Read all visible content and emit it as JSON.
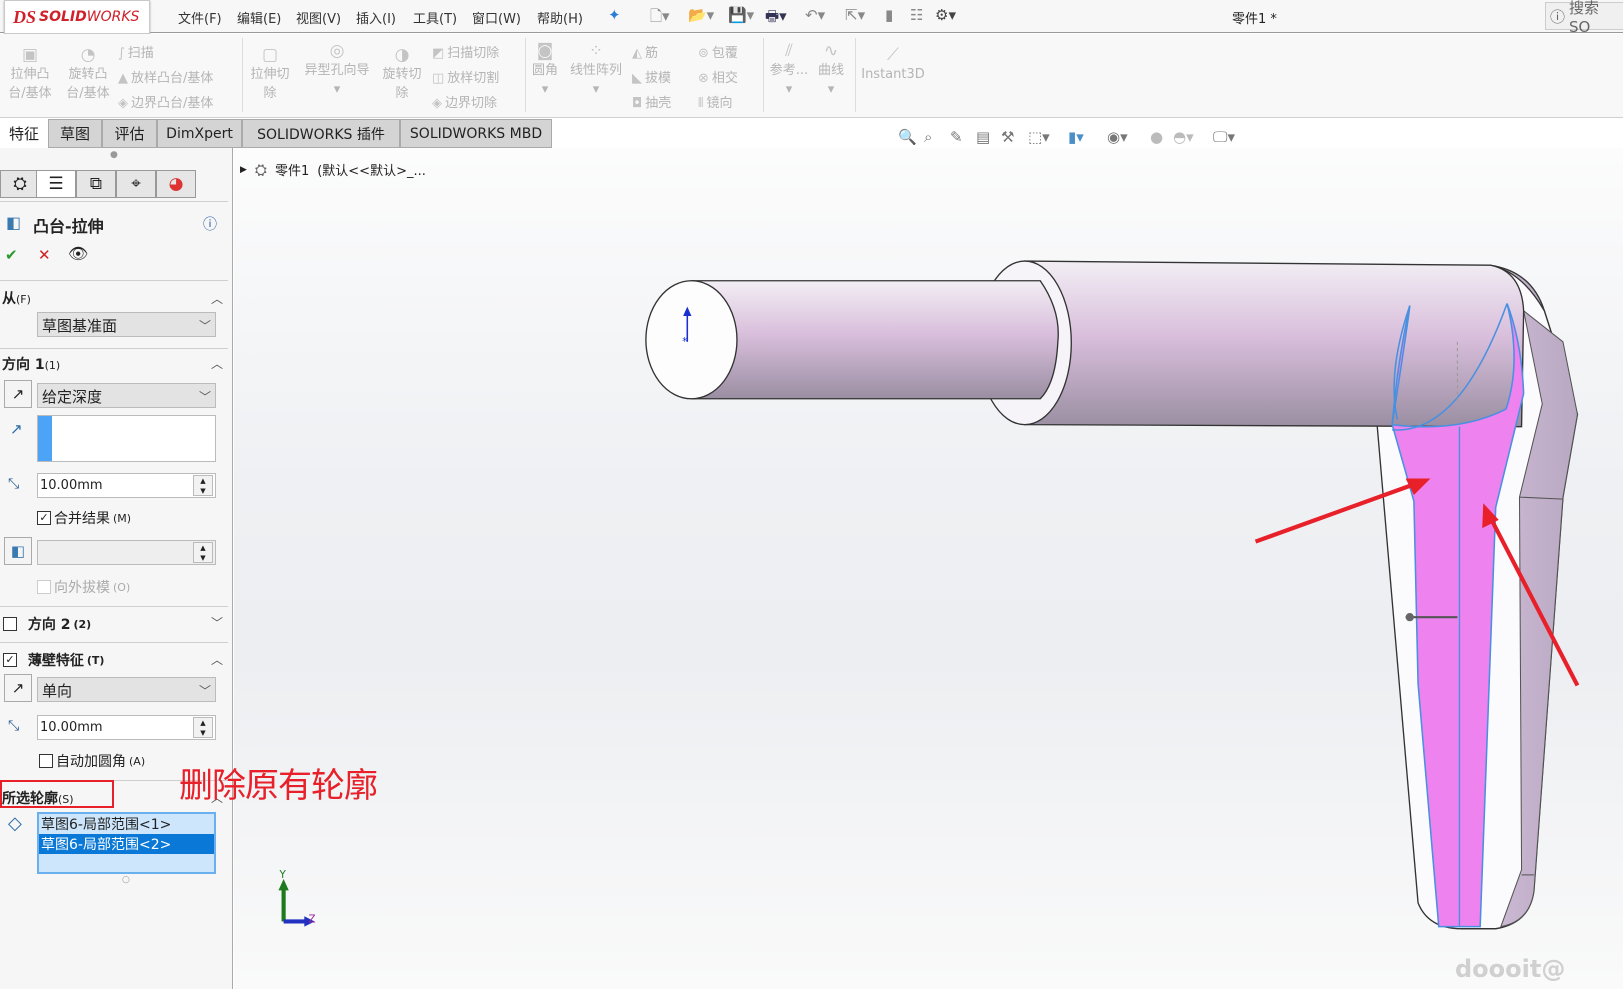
{
  "app": {
    "logo_ds": "DS",
    "logo_text_bold": "SOLID",
    "logo_text_light": "WORKS",
    "document_title": "零件1 *",
    "search_label": "搜索 SO"
  },
  "menu": [
    "文件(F)",
    "编辑(E)",
    "视图(V)",
    "插入(I)",
    "工具(T)",
    "窗口(W)",
    "帮助(H)"
  ],
  "ribbon": {
    "extrude_boss": "拉伸凸台/基体",
    "revolve_boss": "旋转凸台/基体",
    "sweep": "扫描",
    "loft": "放样凸台/基体",
    "boundary": "边界凸台/基体",
    "extrude_cut": "拉伸切除",
    "hole_wizard": "异型孔向导",
    "revolve_cut": "旋转切除",
    "swept_cut": "扫描切除",
    "lofted_cut": "放样切割",
    "boundary_cut": "边界切除",
    "fillet": "圆角",
    "linear_pattern": "线性阵列",
    "rib": "筋",
    "draft": "拔模",
    "shell": "抽壳",
    "wrap": "包覆",
    "intersect": "相交",
    "mirror": "镜向",
    "reference": "参考...",
    "curves": "曲线",
    "instant3d": "Instant3D"
  },
  "tabs": [
    {
      "label": "特征",
      "active": true
    },
    {
      "label": "草图"
    },
    {
      "label": "评估"
    },
    {
      "label": "DimXpert"
    },
    {
      "label": "SOLIDWORKS 插件"
    },
    {
      "label": "SOLIDWORKS MBD"
    }
  ],
  "tree": {
    "part": "零件1",
    "config": "(默认<<默认>_..."
  },
  "property_manager": {
    "title": "凸台-拉伸",
    "from": {
      "label": "从",
      "key": "(F)",
      "value": "草图基准面"
    },
    "direction1": {
      "label": "方向 1",
      "key": "(1)",
      "end_condition": "给定深度",
      "depth": "10.00mm",
      "merge_result": "合并结果",
      "merge_key": "(M)",
      "merge_checked": true,
      "draft_outward": "向外拔模",
      "draft_key": "(O)"
    },
    "direction2": {
      "label": "方向 2",
      "key": "(2)",
      "checked": false
    },
    "thin_feature": {
      "label": "薄壁特征",
      "key": "(T)",
      "checked": true,
      "type": "单向",
      "thickness": "10.00mm",
      "auto_fillet": "自动加圆角",
      "auto_fillet_key": "(A)",
      "auto_fillet_checked": false
    },
    "selected_contours": {
      "label": "所选轮廓",
      "key": "(S)",
      "items": [
        "草图6-局部范围<1>",
        "草图6-局部范围<2>"
      ],
      "selected_index": 1
    }
  },
  "annotation": {
    "text": "删除原有轮廓",
    "color": "#e8202a"
  },
  "triad": {
    "y": "Y",
    "z": "Z"
  },
  "watermark": "doooit@",
  "colors": {
    "accent": "#0078d7",
    "selected_face": "#ee82ee",
    "brand": "#d0202a"
  }
}
